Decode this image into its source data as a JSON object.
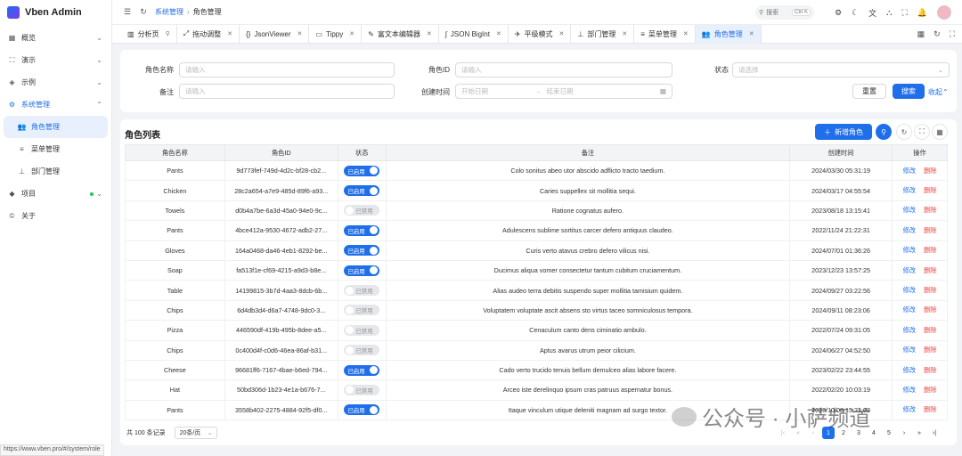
{
  "app": {
    "name": "Vben Admin"
  },
  "sidebar": {
    "items": [
      {
        "label": "概览",
        "icon": "grid-icon"
      },
      {
        "label": "演示",
        "icon": "scan-icon"
      },
      {
        "label": "示例",
        "icon": "layers-icon"
      },
      {
        "label": "系统管理",
        "icon": "gear-icon"
      },
      {
        "label": "角色管理",
        "icon": "users-icon"
      },
      {
        "label": "菜单管理",
        "icon": "list-icon"
      },
      {
        "label": "部门管理",
        "icon": "org-icon"
      },
      {
        "label": "项目",
        "icon": "vben-icon"
      },
      {
        "label": "关于",
        "icon": "copyright-icon"
      }
    ]
  },
  "header": {
    "breadcrumb": [
      "系统管理",
      "角色管理"
    ],
    "search_label": "搜索",
    "search_shortcut": "Ctrl K"
  },
  "tabs": [
    "分析页",
    "拖动调整",
    "JsonViewer",
    "Tippy",
    "富文本编辑器",
    "JSON BigInt",
    "平级模式",
    "部门管理",
    "菜单管理",
    "角色管理"
  ],
  "form": {
    "role_name_label": "角色名称",
    "role_name_placeholder": "请输入",
    "role_id_label": "角色ID",
    "role_id_placeholder": "请输入",
    "status_label": "状态",
    "status_placeholder": "请选择",
    "remark_label": "备注",
    "remark_placeholder": "请输入",
    "created_label": "创建时间",
    "start_placeholder": "开始日期",
    "range_sep": "→",
    "end_placeholder": "结束日期",
    "reset": "重置",
    "search": "搜索",
    "collapse": "收起"
  },
  "table": {
    "title": "角色列表",
    "new_button": "新增角色",
    "headers": [
      "角色名称",
      "角色ID",
      "状态",
      "备注",
      "创建时间",
      "操作"
    ],
    "edit_label": "修改",
    "delete_label": "删除",
    "on_label": "已启用",
    "off_label": "已禁用",
    "rows": [
      {
        "name": "Pants",
        "id": "9d773fef-749d-4d2c-bf28-cb2...",
        "on": true,
        "remark": "Colo sonitus abeo utor abscido adflicto tracto taedium.",
        "time": "2024/03/30 05:31:19"
      },
      {
        "name": "Chicken",
        "id": "28c2a654-a7e9-485d-89f6-a93...",
        "on": true,
        "remark": "Caries suppellex sit mollitia sequi.",
        "time": "2024/03/17 04:55:54"
      },
      {
        "name": "Towels",
        "id": "d0b4a7be-6a3d-45a0-94e0-9c...",
        "on": false,
        "remark": "Ratione cognatus aufero.",
        "time": "2023/08/18 13:15:41"
      },
      {
        "name": "Pants",
        "id": "4bce412a-9530-4672-adb2-27...",
        "on": true,
        "remark": "Adulescens sublime sortitus carcer defero antiquus claudeo.",
        "time": "2022/11/24 21:22:31"
      },
      {
        "name": "Gloves",
        "id": "164a0468-da46-4eb1-8292-be...",
        "on": true,
        "remark": "Curis verto atavus crebro defero vilicus nisi.",
        "time": "2024/07/01 01:36:26"
      },
      {
        "name": "Soap",
        "id": "fa513f1e-cf69-4215-a9d3-b8e...",
        "on": true,
        "remark": "Ducimus aliqua vomer consectetur tantum cubitum cruciamentum.",
        "time": "2023/12/23 13:57:25"
      },
      {
        "name": "Table",
        "id": "14199815-3b7d-4aa3-8dcb-6b...",
        "on": false,
        "remark": "Alias audeo terra debitis suspendo super mollitia tamisium quidem.",
        "time": "2024/09/27 03:22:56"
      },
      {
        "name": "Chips",
        "id": "6d4db3d4-d6a7-4748-9dc0-3...",
        "on": false,
        "remark": "Voluptatem voluptate ascit absens sto virtus taceo somniculosus tempora.",
        "time": "2024/09/11 08:23:06"
      },
      {
        "name": "Pizza",
        "id": "446590df-419b-495b-8dee-a5...",
        "on": false,
        "remark": "Cenaculum canto dens ciminatio ambulo.",
        "time": "2022/07/24 09:31:05"
      },
      {
        "name": "Chips",
        "id": "0c400d4f-c0d6-46ea-86af-b31...",
        "on": false,
        "remark": "Aptus avarus utrum peior cilicium.",
        "time": "2024/06/27 04:52:50"
      },
      {
        "name": "Cheese",
        "id": "96681ff6-7167-4bae-b6ed-794...",
        "on": true,
        "remark": "Cado verto trucido tenuis bellum demulceo alias labore facere.",
        "time": "2023/02/22 23:44:55"
      },
      {
        "name": "Hat",
        "id": "50bd306d-1b23-4e1a-b676-7...",
        "on": false,
        "remark": "Arceo iste derelinquo ipsum cras patruus aspernatur bonus.",
        "time": "2022/02/20 10:03:19"
      },
      {
        "name": "Pants",
        "id": "3558b402-2275-4884-92f5-df0...",
        "on": true,
        "remark": "Itaque vinculum utique deleniti magnam ad surgo textor.",
        "time": "2023/10/08 15:21:08"
      }
    ]
  },
  "pager": {
    "total": "共 100 条记录",
    "page_size": "20条/页",
    "pages": [
      "1",
      "2",
      "3",
      "4",
      "5"
    ]
  },
  "statusbar": {
    "url": "https://www.vben.pro/#/system/role"
  },
  "watermark": {
    "text": "公众号 · 小萨频道"
  }
}
